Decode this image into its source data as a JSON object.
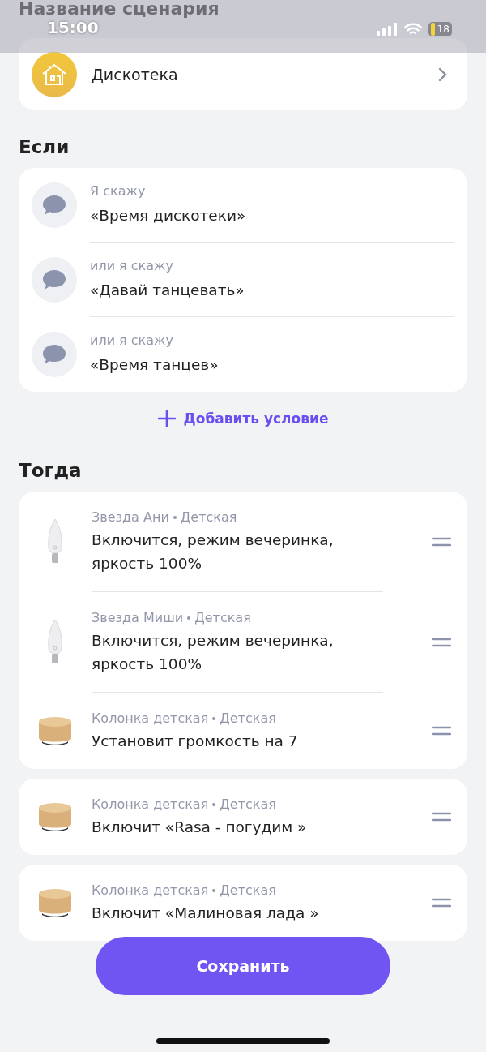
{
  "status_bar": {
    "time": "15:00",
    "battery": "18"
  },
  "title": "Название сценария",
  "scenario": {
    "name": "Дискотека"
  },
  "if_section": {
    "heading": "Если",
    "conditions": [
      {
        "label": "Я скажу",
        "phrase": "«Время дискотеки»"
      },
      {
        "label": "или я скажу",
        "phrase": "«Давай танцевать»"
      },
      {
        "label": "или я скажу",
        "phrase": "«Время танцев»"
      }
    ],
    "add_button": "Добавить условие"
  },
  "then_section": {
    "heading": "Тогда",
    "groups": [
      {
        "actions": [
          {
            "kind": "bulb",
            "device": "Звезда Ани",
            "room": "Детская",
            "text": "Включится, режим вечеринка, яркость 100%"
          },
          {
            "kind": "bulb",
            "device": "Звезда Миши",
            "room": "Детская",
            "text": "Включится, режим вечеринка, яркость 100%"
          },
          {
            "kind": "speaker",
            "device": "Колонка детская",
            "room": "Детская",
            "text": "Установит громкость на 7"
          }
        ]
      },
      {
        "actions": [
          {
            "kind": "speaker",
            "device": "Колонка детская",
            "room": "Детская",
            "text": "Включит «Rasa - погудим »"
          }
        ]
      },
      {
        "actions": [
          {
            "kind": "speaker",
            "device": "Колонка детская",
            "room": "Детская",
            "text": "Включит «Малиновая лада »"
          }
        ]
      }
    ]
  },
  "save_button": "Сохранить"
}
